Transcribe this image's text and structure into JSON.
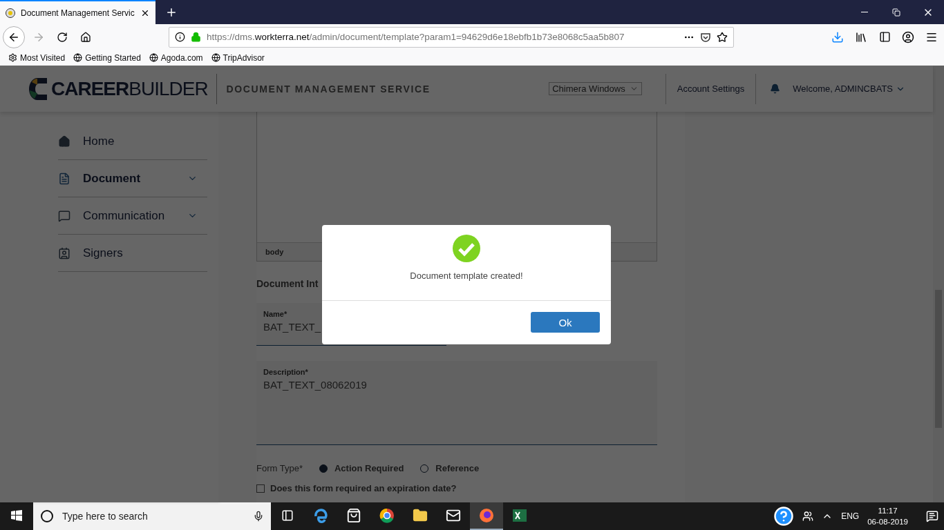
{
  "browser": {
    "tabs": [
      {
        "title": "Document Management Servic",
        "selected": true
      }
    ],
    "url": {
      "scheme": "https://dms.",
      "domain": "workterra.net",
      "path": "/admin/document/template?param1=94629d6e18ebfb1b73e8068c5aa5b807"
    },
    "bookmarks": [
      {
        "label": "Most Visited",
        "kind": "gear"
      },
      {
        "label": "Getting Started",
        "kind": "globe"
      },
      {
        "label": "Agoda.com",
        "kind": "globe"
      },
      {
        "label": "TripAdvisor",
        "kind": "globe"
      }
    ]
  },
  "header": {
    "logo_bold": "CAREER",
    "logo_light": "BUILDER",
    "title": "DOCUMENT MANAGEMENT SERVICE",
    "company": "Chimera Windows",
    "account": "Account Settings",
    "welcome": "Welcome, ADMINCBATS"
  },
  "sidebar": {
    "items": [
      {
        "label": "Home",
        "kind": "home",
        "selected": false,
        "submenu": false
      },
      {
        "label": "Document",
        "kind": "document",
        "selected": true,
        "submenu": true
      },
      {
        "label": "Communication",
        "kind": "chat",
        "selected": false,
        "submenu": true
      },
      {
        "label": "Signers",
        "kind": "badge",
        "selected": false,
        "submenu": false
      }
    ]
  },
  "editor": {
    "status": "body"
  },
  "form": {
    "heading": "Document Int",
    "name_label": "Name*",
    "name_value": "BAT_TEXT_",
    "description_label": "Description*",
    "description_value": "BAT_TEXT_08062019",
    "form_type_label": "Form Type*",
    "form_types": [
      {
        "label": "Action Required",
        "selected": true
      },
      {
        "label": "Reference",
        "selected": false
      }
    ],
    "expiration": {
      "label": "Does this form required an expiration date?",
      "checked": false
    }
  },
  "modal": {
    "message": "Document template created!",
    "button": "Ok"
  },
  "taskbar": {
    "search_placeholder": "Type here to search",
    "apps": [
      {
        "kind": "edge",
        "selected": false
      },
      {
        "kind": "store",
        "selected": false
      },
      {
        "kind": "chrome",
        "selected": false
      },
      {
        "kind": "explorer",
        "selected": false
      },
      {
        "kind": "mail",
        "selected": false
      },
      {
        "kind": "firefox",
        "selected": true
      },
      {
        "kind": "excel",
        "selected": false
      }
    ],
    "language": "ENG",
    "time": "11:17",
    "date": "06-08-2019"
  }
}
